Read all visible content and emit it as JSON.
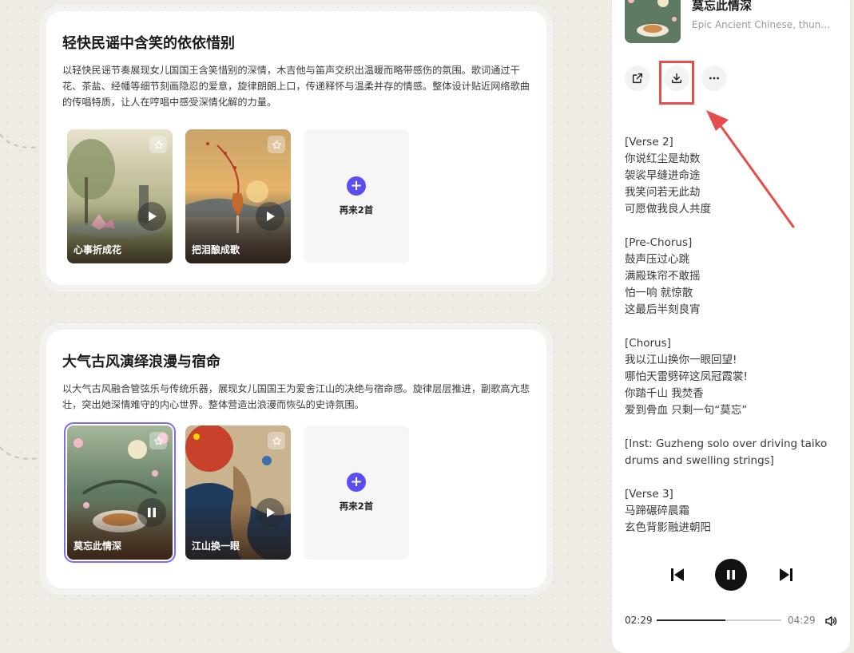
{
  "cards": [
    {
      "title": "轻快民谣中含笑的依依惜别",
      "description": "以轻快民谣节奏展现女儿国国王含笑惜别的深情，木吉他与笛声交织出温暖而略带感伤的氛围。歌词通过干花、茶盐、经幡等细节刻画隐忍的爱意，旋律朗朗上口，传递释怀与温柔并存的情感。整体设计贴近网络歌曲的传唱特质，让人在哼唱中感受深情化解的力量。",
      "songs": [
        {
          "title": "心事折成花",
          "icon": "star-icon",
          "control": "play-icon"
        },
        {
          "title": "把泪酿成歌",
          "icon": "star-icon",
          "control": "play-icon"
        }
      ],
      "more_label": "再来2首"
    },
    {
      "title": "大气古风演绎浪漫与宿命",
      "description": "以大气古风融合管弦乐与传统乐器，展现女儿国国王为爱舍江山的决绝与宿命感。旋律层层推进，副歌高亢悲壮，突出她深情难守的内心世界。整体营造出浪漫而恢弘的史诗氛围。",
      "songs": [
        {
          "title": "莫忘此情深",
          "icon": "star-icon",
          "control": "pause-icon",
          "selected": true
        },
        {
          "title": "江山换一眼",
          "icon": "star-icon",
          "control": "play-icon"
        }
      ],
      "more_label": "再来2首"
    }
  ],
  "now_playing": {
    "title": "莫忘此情深",
    "subtitle": "Epic Ancient Chinese, thunderous drums, guzheng",
    "actions": [
      "share-icon",
      "download-icon",
      "more-icon"
    ]
  },
  "lyrics": [
    "[Verse 2]",
    "你说红尘是劫数",
    "袈裟早缝进命途",
    "我笑问若无此劫",
    "可愿做我良人共度",
    "",
    "[Pre-Chorus]",
    "鼓声压过心跳",
    "满殿珠帘不敢摇",
    "怕一响 就惊散",
    "这最后半刻良宵",
    "",
    "[Chorus]",
    "我以江山换你一眼回望!",
    "哪怕天雷劈碎这凤冠霞裳!",
    "你踏千山 我焚香",
    "爱到骨血 只剩一句“莫忘”",
    "",
    "[Inst: Guzheng solo over driving taiko drums and swelling strings]",
    "",
    "[Verse 3]",
    "马蹄碾碎晨霜",
    "玄色背影融进朝阳"
  ],
  "player": {
    "current_time": "02:29",
    "total_time": "04:29",
    "progress": 0.55,
    "controls": [
      "skip-back-icon",
      "pause-icon",
      "skip-forward-icon",
      "volume-icon"
    ]
  },
  "colors": {
    "accent": "#5b4df0",
    "selection": "#7c6cf0",
    "annotation": "#e64d4d"
  }
}
